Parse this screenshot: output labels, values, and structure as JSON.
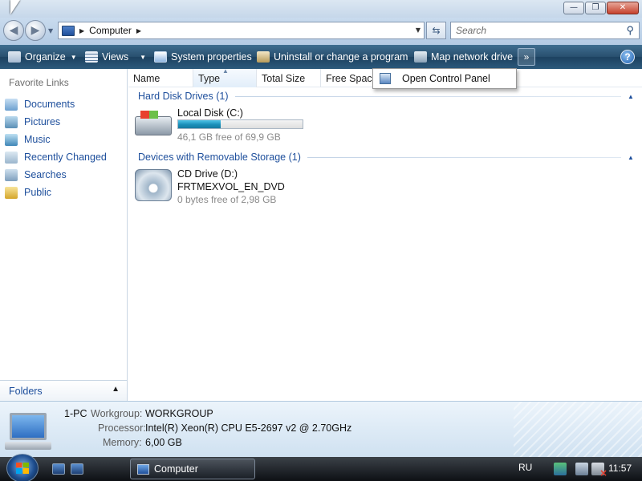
{
  "address_bar": {
    "path": "Computer",
    "search_placeholder": "Search"
  },
  "toolbar": {
    "organize": "Organize",
    "views": "Views",
    "system_properties": "System properties",
    "uninstall": "Uninstall or change a program",
    "map_network_drive": "Map network drive",
    "overflow": "»",
    "help": "?"
  },
  "dropdown_menu": {
    "items": [
      {
        "label": "Open Control Panel"
      }
    ]
  },
  "left_pane": {
    "heading": "Favorite Links",
    "items": [
      {
        "label": "Documents",
        "icon": "documents-icon"
      },
      {
        "label": "Pictures",
        "icon": "pictures-icon"
      },
      {
        "label": "Music",
        "icon": "music-icon"
      },
      {
        "label": "Recently Changed",
        "icon": "recent-icon"
      },
      {
        "label": "Searches",
        "icon": "searches-icon"
      },
      {
        "label": "Public",
        "icon": "public-folder-icon"
      }
    ],
    "folders_label": "Folders"
  },
  "columns": [
    "Name",
    "Type",
    "Total Size",
    "Free Space"
  ],
  "groups": [
    {
      "title": "Hard Disk Drives (1)",
      "drives": [
        {
          "name": "Local Disk (C:)",
          "free_text": "46,1 GB free of 69,9 GB",
          "used_fraction": 0.34
        }
      ]
    },
    {
      "title": "Devices with Removable Storage (1)",
      "drives": [
        {
          "name": "CD Drive (D:)",
          "volume_label": "FRTMEXVOL_EN_DVD",
          "free_text": "0 bytes free of 2,98 GB"
        }
      ]
    }
  ],
  "details": {
    "computer_name": "1-PC",
    "workgroup_label": "Workgroup:",
    "workgroup": "WORKGROUP",
    "processor_label": "Processor:",
    "processor": "Intel(R) Xeon(R) CPU E5-2697 v2 @ 2.70GHz",
    "memory_label": "Memory:",
    "memory": "6,00 GB"
  },
  "taskbar": {
    "task_label": "Computer",
    "language": "RU",
    "clock": "11:57"
  },
  "colors": {
    "toolbar_bg": "#2c5a7c",
    "link_blue": "#1e4f9c",
    "capacity_fill": "#1a8fb9"
  }
}
